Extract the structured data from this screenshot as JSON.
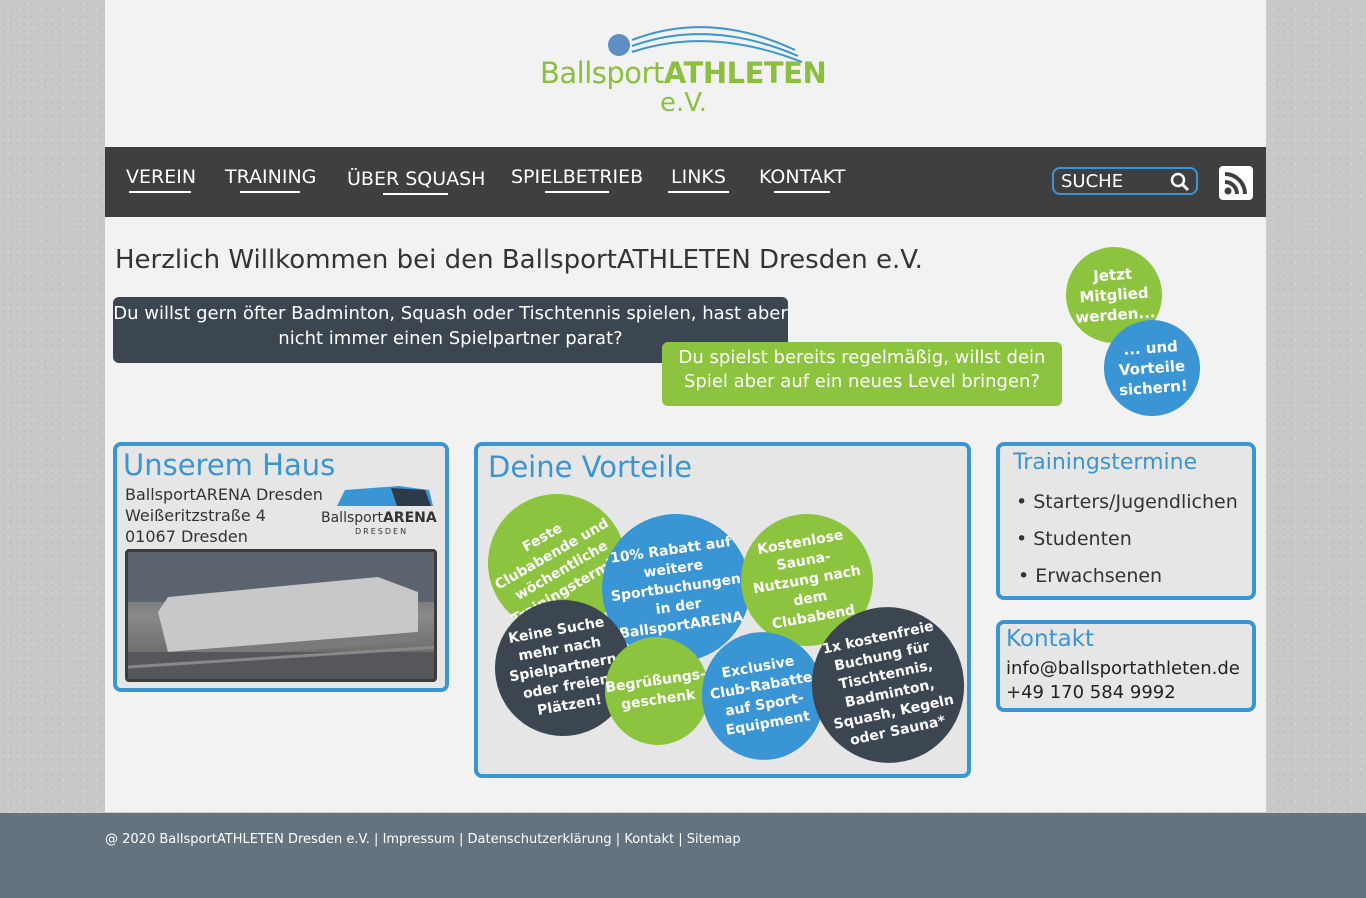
{
  "logo": {
    "part1": "Ballsport",
    "part2": "ATHLETEN",
    "suffix": "e.V."
  },
  "nav": {
    "items": [
      {
        "label": "VEREIN"
      },
      {
        "label": "TRAINING"
      },
      {
        "label": "ÜBER SQUASH"
      },
      {
        "label": "SPIELBETRIEB"
      },
      {
        "label": "LINKS"
      },
      {
        "label": "KONTAKT"
      }
    ],
    "search_label": "SUCHE",
    "rss_icon": "rss-icon"
  },
  "welcome": {
    "heading": "Herzlich Willkommen bei den BallsportATHLETEN Dresden e.V.",
    "dark_text": "Du willst gern öfter Badminton, Squash oder Tischtennis spielen, hast aber nicht immer einen Spielpartner parat?",
    "green_text": "Du spielst bereits regelmäßig, willst dein Spiel aber auf ein neues Level bringen?",
    "circle_green": "Jetzt Mitglied werden...",
    "circle_blue": "... und Vorteile sichern!"
  },
  "haus": {
    "title": "Unserem Haus",
    "line1": "BallsportARENA Dresden",
    "line2": "Weißeritzstraße 4",
    "line3": "01067 Dresden",
    "arena_logo_main": "Ballsport",
    "arena_logo_bold": "ARENA",
    "arena_logo_sub": "DRESDEN"
  },
  "vorteile": {
    "title": "Deine Vorteile",
    "items": [
      "Feste Clubabende und wöchentliche Trainingstermine",
      "10% Rabatt auf weitere Sportbuchungen in der BallsportARENA",
      "Kostenlose Sauna-Nutzung nach dem Clubabend",
      "Keine Suche mehr nach Spielpartnern oder freien Plätzen!",
      "Begrüßungs-geschenk",
      "Exclusive Club-Rabatte auf Sport-Equipment",
      "1x kostenfreie Buchung für Tischtennis, Badminton, Squash, Kegeln oder Sauna*"
    ]
  },
  "training": {
    "title": "Trainingstermine",
    "items": [
      "• Starters/Jugendlichen",
      "• Studenten",
      "• Erwachsenen"
    ]
  },
  "kontakt": {
    "title": "Kontakt",
    "email": "info@ballsportathleten.de",
    "phone": "+49 170 584 9992"
  },
  "footer": {
    "copyright": "@ 2020 BallsportATHLETEN Dresden e.V.",
    "sep": "|",
    "links": [
      "Impressum",
      "Datenschutzerklärung",
      "Kontakt",
      "Sitemap"
    ]
  },
  "colors": {
    "green": "#8cc43f",
    "blue": "#3a95d4",
    "dark": "#3c4650",
    "nav": "#3f3f3f",
    "footer": "#64737e"
  }
}
